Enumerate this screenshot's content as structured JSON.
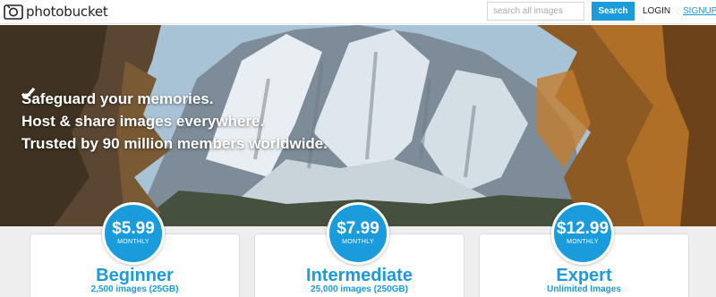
{
  "header": {
    "logo_text": "photobucket",
    "search_placeholder": "search all images",
    "search_button": "Search",
    "login": "LOGIN",
    "signup": "SIGNUP"
  },
  "hero": {
    "bullets": [
      "Safeguard your memories.",
      "Host & share images everywhere.",
      "Trusted by 90 million members worldwide."
    ]
  },
  "plans": [
    {
      "price": "$5.99",
      "period": "MONTHLY",
      "name": "Beginner",
      "detail": "2,500 images (25GB)"
    },
    {
      "price": "$7.99",
      "period": "MONTHLY",
      "name": "Intermediate",
      "detail": "25,000 images (250GB)"
    },
    {
      "price": "$12.99",
      "period": "MONTHLY",
      "name": "Expert",
      "detail": "Unlimited Images"
    }
  ],
  "colors": {
    "accent": "#1a9bdc",
    "text": "#222222"
  },
  "icons": {
    "logo": "camera-logo-icon",
    "bullet": "checkmark-icon"
  }
}
